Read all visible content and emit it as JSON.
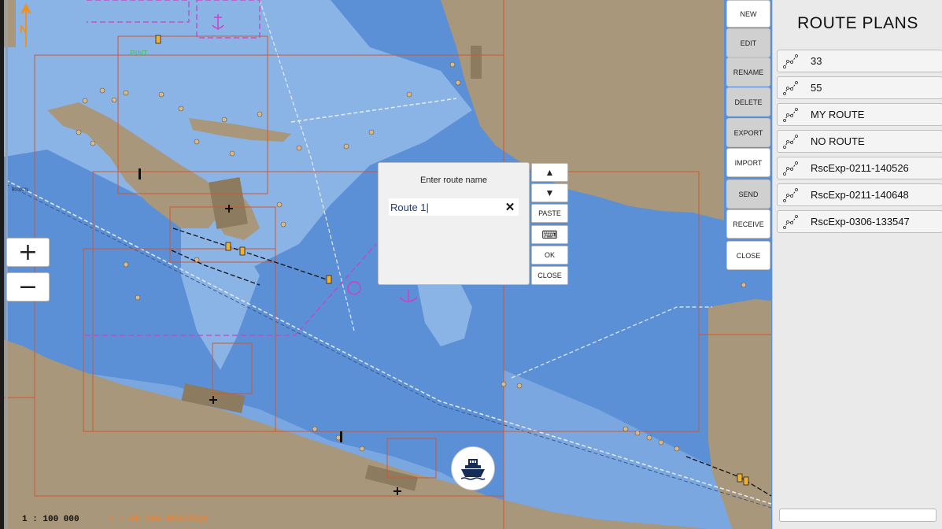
{
  "map": {
    "scale_main": "1 : 100 000",
    "scale_cell": "1 : 90 000  RU3NTKQ0",
    "north_label": "N",
    "zoom_in": "+",
    "zoom_out": "−",
    "chart_labels": {
      "place": "PINT",
      "lat": "60°00'N"
    },
    "colors": {
      "deep_water": "#5b8fd6",
      "shallow_water": "#8ab3e6",
      "land": "#a8977a",
      "cell_border": "#d2572f",
      "restricted": "#cc40c8"
    }
  },
  "dialog": {
    "title": "Enter route name",
    "value": "Route 1|",
    "clear_icon": "✕",
    "buttons": {
      "up": "▲",
      "down": "▼",
      "paste": "PASTE",
      "keyboard": "⌨",
      "ok": "OK",
      "close": "CLOSE"
    }
  },
  "toolbar": {
    "new": "NEW",
    "edit": "EDIT",
    "rename": "RENAME",
    "delete": "DELETE",
    "export": "EXPORT",
    "import": "IMPORT",
    "send": "SEND",
    "receive": "RECEIVE",
    "close": "CLOSE"
  },
  "panel": {
    "title": "ROUTE PLANS",
    "routes": [
      {
        "label": "33"
      },
      {
        "label": "55"
      },
      {
        "label": "MY ROUTE"
      },
      {
        "label": "NO ROUTE"
      },
      {
        "label": "RscExp-0211-140526"
      },
      {
        "label": "RscExp-0211-140648"
      },
      {
        "label": "RscExp-0306-133547"
      }
    ]
  }
}
